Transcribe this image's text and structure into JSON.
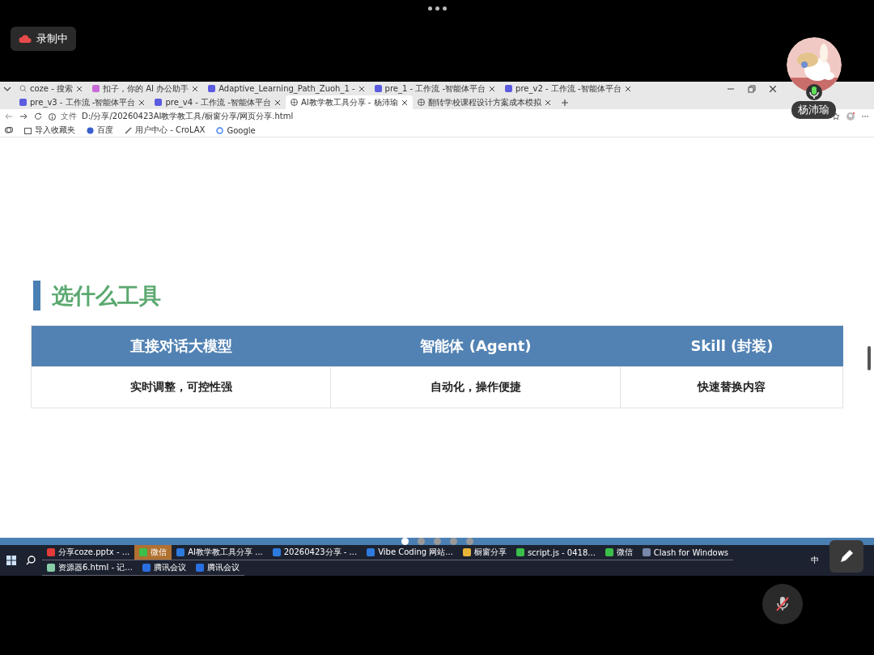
{
  "meeting": {
    "recording_label": "录制中",
    "speaker_name": "杨沛瑜",
    "mic_muted": true
  },
  "browser": {
    "tabs": [
      {
        "label": "coze - 搜索",
        "selected": false
      },
      {
        "label": "扣子，你的 AI 办公助手",
        "selected": false
      },
      {
        "label": "Adaptive_Learning_Path_Zuoh_1 -",
        "selected": false
      },
      {
        "label": "pre_1 - 工作流 -智能体平台",
        "selected": false
      },
      {
        "label": "pre_v2 - 工作流 -智能体平台",
        "selected": false
      },
      {
        "label": "pre_v3 - 工作流 -智能体平台",
        "selected": false
      },
      {
        "label": "pre_v4 - 工作流 -智能体平台",
        "selected": false
      },
      {
        "label": "AI教学教工具分享 - 杨沛瑜",
        "selected": true
      },
      {
        "label": "翻转学校课程设计方案成本模拟",
        "selected": false
      }
    ],
    "address_prefix": "文件",
    "address": "D:/分享/20260423AI教学教工具/橱窗分享/网页分享.html",
    "bookmarks": [
      "导入收藏夹",
      "百度",
      "用户中心 - CroLAX",
      "Google"
    ]
  },
  "slide": {
    "heading": "选什么工具",
    "columns": [
      "直接对话大模型",
      "智能体 (Agent)",
      "Skill (封装)"
    ],
    "cells": [
      "实时调整，可控性强",
      "自动化，操作便捷",
      "快速替换内容"
    ],
    "dots": [
      {
        "selected": true
      },
      {
        "selected": false
      },
      {
        "selected": false
      },
      {
        "selected": false
      },
      {
        "selected": false
      }
    ]
  },
  "taskbar": {
    "items": [
      {
        "label": "分享coze.pptx - ...",
        "selected": false
      },
      {
        "label": "微信",
        "selected": true
      },
      {
        "label": "AI教学教工具分享 ...",
        "selected": false
      },
      {
        "label": "20260423分享 - ...",
        "selected": false
      },
      {
        "label": "Vibe Coding 网站...",
        "selected": false
      },
      {
        "label": "橱窗分享",
        "selected": false
      },
      {
        "label": "script.js - 0418...",
        "selected": false
      },
      {
        "label": "微信",
        "selected": false
      },
      {
        "label": "Clash for Windows",
        "selected": false
      },
      {
        "label": "资源器6.html - 记...",
        "selected": false
      },
      {
        "label": "腾讯会议",
        "selected": false
      },
      {
        "label": "腾讯会议",
        "selected": false
      }
    ],
    "input_method": "中"
  }
}
